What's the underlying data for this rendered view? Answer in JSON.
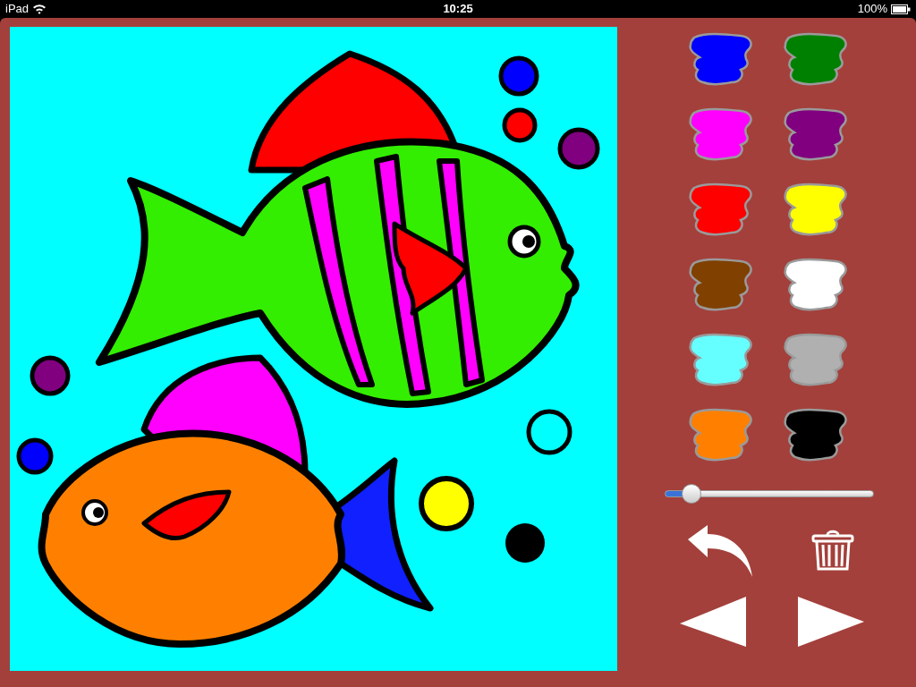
{
  "status_bar": {
    "device": "iPad",
    "time": "10:25",
    "battery": "100%"
  },
  "palette": [
    {
      "color": "#0000ff"
    },
    {
      "color": "#008000"
    },
    {
      "color": "#ff00ff"
    },
    {
      "color": "#800080"
    },
    {
      "color": "#ff0000"
    },
    {
      "color": "#ffff00"
    },
    {
      "color": "#804000"
    },
    {
      "color": "#ffffff"
    },
    {
      "color": "#66ffff"
    },
    {
      "color": "#b0b0b0"
    },
    {
      "color": "#ff8000"
    },
    {
      "color": "#000000"
    }
  ],
  "brush_size": {
    "level": 0.13
  }
}
